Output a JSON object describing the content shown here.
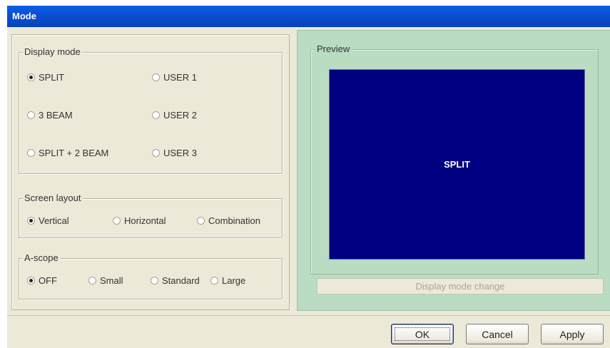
{
  "window": {
    "title": "Mode"
  },
  "display_mode": {
    "legend": "Display mode",
    "options": [
      {
        "label": "SPLIT",
        "selected": true
      },
      {
        "label": "3 BEAM",
        "selected": false
      },
      {
        "label": "SPLIT + 2 BEAM",
        "selected": false
      },
      {
        "label": "USER 1",
        "selected": false
      },
      {
        "label": "USER 2",
        "selected": false
      },
      {
        "label": "USER 3",
        "selected": false
      }
    ]
  },
  "screen_layout": {
    "legend": "Screen layout",
    "options": [
      {
        "label": "Vertical",
        "selected": true
      },
      {
        "label": "Horizontal",
        "selected": false
      },
      {
        "label": "Combination",
        "selected": false
      }
    ]
  },
  "a_scope": {
    "legend": "A-scope",
    "options": [
      {
        "label": "OFF",
        "selected": true
      },
      {
        "label": "Small",
        "selected": false
      },
      {
        "label": "Standard",
        "selected": false
      },
      {
        "label": "Large",
        "selected": false
      }
    ]
  },
  "preview": {
    "legend": "Preview",
    "screen_text": "SPLIT",
    "screen_color": "#000080",
    "change_button": "Display mode change"
  },
  "buttons": {
    "ok": "OK",
    "cancel": "Cancel",
    "apply": "Apply"
  }
}
